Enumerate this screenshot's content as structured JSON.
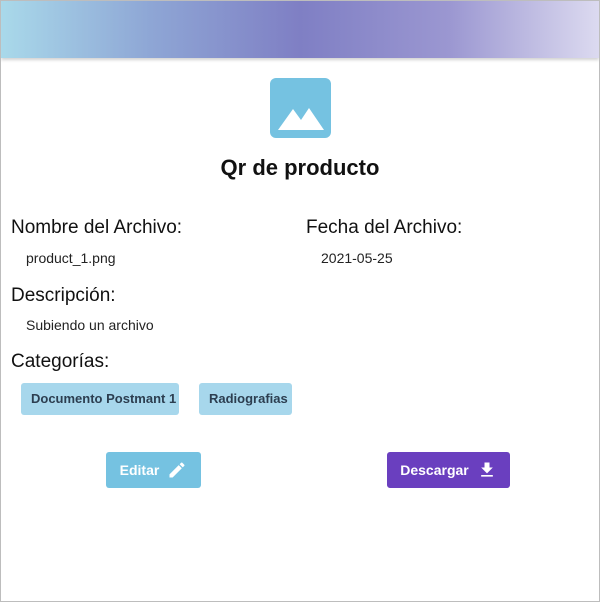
{
  "header": {
    "title": "Qr de producto"
  },
  "image_icon": "image-placeholder-icon",
  "fields": {
    "file_name": {
      "label": "Nombre del Archivo:",
      "value": "product_1.png"
    },
    "file_date": {
      "label": "Fecha del Archivo:",
      "value": "2021-05-25"
    },
    "description": {
      "label": "Descripción:",
      "value": "Subiendo un archivo"
    },
    "categories": {
      "label": "Categorías:",
      "items": [
        "Documento Postmant 1",
        "Radiografias"
      ]
    }
  },
  "actions": {
    "edit_label": "Editar",
    "edit_icon": "pencil-icon",
    "download_label": "Descargar",
    "download_icon": "download-icon"
  },
  "colors": {
    "accent_light": "#75c2e1",
    "chip_bg": "#a7d7ec",
    "primary": "#6a3fbf"
  }
}
